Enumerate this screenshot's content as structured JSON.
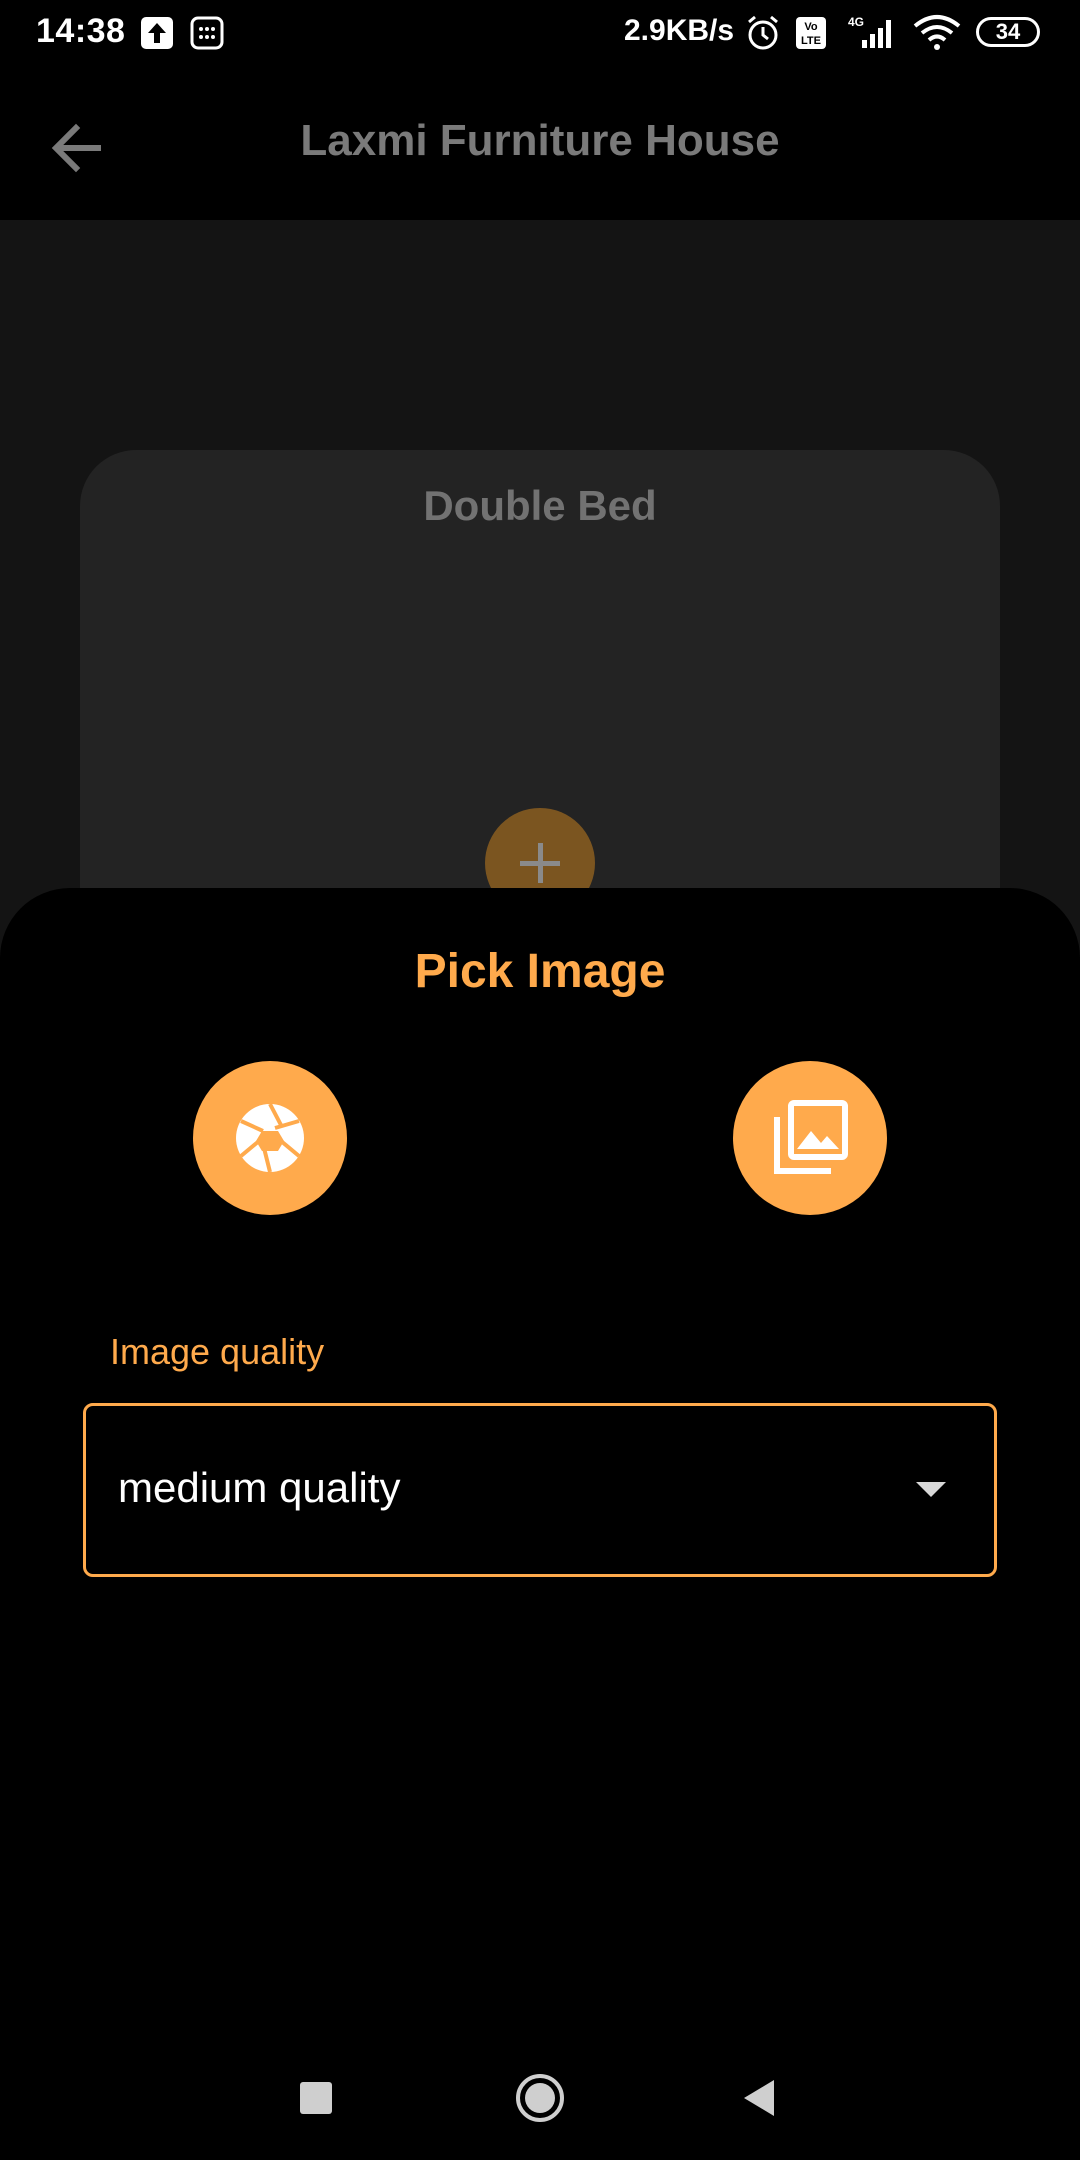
{
  "status_bar": {
    "time": "14:38",
    "network_speed": "2.9KB/s",
    "network_type": "4G",
    "volte": "Vo LTE",
    "battery": "34",
    "icons": [
      "upload-icon",
      "calculator-icon",
      "alarm-icon",
      "volte-icon",
      "signal-icon",
      "wifi-icon",
      "battery-icon"
    ]
  },
  "app_bar": {
    "title": "Laxmi Furniture House",
    "back_icon": "arrow-back-icon"
  },
  "card": {
    "title": "Double Bed",
    "add_icon": "plus-icon"
  },
  "sheet": {
    "title": "Pick Image",
    "camera_icon": "camera-shutter-icon",
    "gallery_icon": "photo-library-icon",
    "quality_label": "Image quality",
    "quality_value": "medium quality"
  },
  "nav": {
    "icons": [
      "recent-apps-icon",
      "home-icon",
      "back-icon"
    ]
  },
  "colors": {
    "accent": "#ffaa4c",
    "background": "#141414",
    "card": "#232323",
    "sheet": "#000000"
  }
}
